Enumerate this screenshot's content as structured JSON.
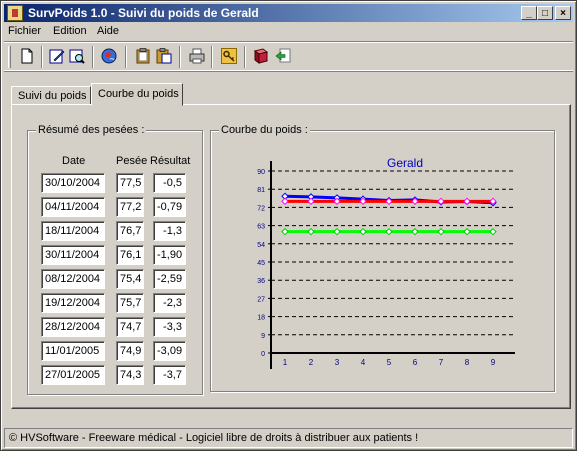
{
  "window": {
    "title": "SurvPoids 1.0 - Suivi du poids de Gerald",
    "minimize_label": "_",
    "maximize_label": "□",
    "close_label": "×"
  },
  "menu": [
    "Fichier",
    "Edition",
    "Aide"
  ],
  "toolbar_icons": [
    "new-icon",
    "edit-icon",
    "zoom-icon",
    "globe-icon",
    "clipboard-icon",
    "paste-icon",
    "print-icon",
    "key-icon",
    "book-icon",
    "export-icon"
  ],
  "tabs": [
    {
      "label": "Suivi du poids",
      "active": false
    },
    {
      "label": "Courbe du poids",
      "active": true
    }
  ],
  "summary": {
    "title": "Résumé des pesées :",
    "headers": {
      "date": "Date",
      "pesee": "Pesée",
      "resultat": "Résultat"
    },
    "rows": [
      {
        "date": "30/10/2004",
        "pesee": "77,5",
        "resultat": "-0,5"
      },
      {
        "date": "04/11/2004",
        "pesee": "77,2",
        "resultat": "-0,79"
      },
      {
        "date": "18/11/2004",
        "pesee": "76,7",
        "resultat": "-1,3"
      },
      {
        "date": "30/11/2004",
        "pesee": "76,1",
        "resultat": "-1,90"
      },
      {
        "date": "08/12/2004",
        "pesee": "75,4",
        "resultat": "-2,59"
      },
      {
        "date": "19/12/2004",
        "pesee": "75,7",
        "resultat": "-2,3"
      },
      {
        "date": "28/12/2004",
        "pesee": "74,7",
        "resultat": "-3,3"
      },
      {
        "date": "11/01/2005",
        "pesee": "74,9",
        "resultat": "-3,09"
      },
      {
        "date": "27/01/2005",
        "pesee": "74,3",
        "resultat": "-3,7"
      }
    ]
  },
  "chart_group_title": "Courbe du poids :",
  "chart_data": {
    "type": "line",
    "title": "Gerald",
    "x": [
      1,
      2,
      3,
      4,
      5,
      6,
      7,
      8,
      9
    ],
    "ylim": [
      0,
      90
    ],
    "yticks": [
      0,
      9,
      18,
      27,
      36,
      45,
      54,
      63,
      72,
      81,
      90
    ],
    "grid": true,
    "series": [
      {
        "color": "#0000ff",
        "marker_color": "#0000ff",
        "values": [
          77.5,
          77.2,
          76.7,
          76.1,
          75.4,
          75.7,
          74.7,
          74.9,
          74.3
        ]
      },
      {
        "color": "#ff0000",
        "marker_color": "#ff00ff",
        "values": [
          75,
          75,
          75,
          75,
          75,
          75,
          75,
          75,
          75
        ]
      },
      {
        "color": "#00ff00",
        "marker_color": "#00cc00",
        "values": [
          60,
          60,
          60,
          60,
          60,
          60,
          60,
          60,
          60
        ]
      }
    ]
  },
  "status": "© HVSoftware - Freeware médical - Logiciel libre de droits à distribuer aux patients !"
}
